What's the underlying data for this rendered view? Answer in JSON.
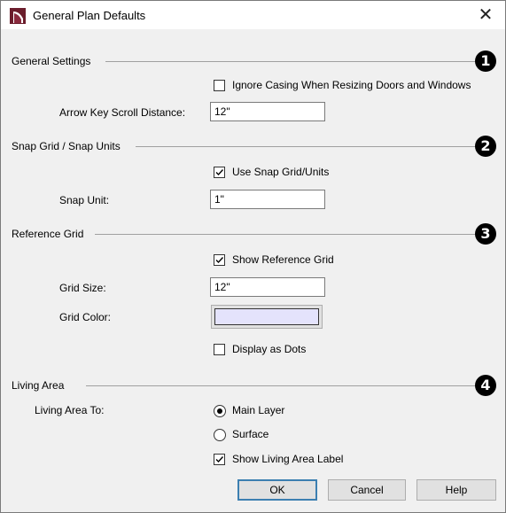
{
  "window": {
    "title": "General Plan Defaults",
    "close_glyph": "✕",
    "app_icon": "chief-architect-icon"
  },
  "colors": {
    "badge": "#000000",
    "grid_color": "#e4e3fc",
    "default_button_border": "#3c7fb1"
  },
  "general_settings": {
    "heading": "General Settings",
    "badge": "1",
    "ignore_casing_label": "Ignore Casing When Resizing Doors and Windows",
    "ignore_casing_checked": false,
    "arrow_key_label": "Arrow Key Scroll Distance:",
    "arrow_key_value": "12\""
  },
  "snap_grid": {
    "heading": "Snap Grid / Snap Units",
    "badge": "2",
    "use_snap_label": "Use Snap Grid/Units",
    "use_snap_checked": true,
    "snap_unit_label": "Snap Unit:",
    "snap_unit_value": "1\""
  },
  "reference_grid": {
    "heading": "Reference Grid",
    "badge": "3",
    "show_grid_label": "Show Reference Grid",
    "show_grid_checked": true,
    "grid_size_label": "Grid Size:",
    "grid_size_value": "12\"",
    "grid_color_label": "Grid Color:",
    "display_dots_label": "Display as Dots",
    "display_dots_checked": false
  },
  "living_area": {
    "heading": "Living Area",
    "badge": "4",
    "living_area_to_label": "Living Area To:",
    "options": [
      "Main Layer",
      "Surface"
    ],
    "selected_option": "Main Layer",
    "show_label_label": "Show Living Area Label",
    "show_label_checked": true
  },
  "buttons": {
    "ok": "OK",
    "cancel": "Cancel",
    "help": "Help"
  }
}
